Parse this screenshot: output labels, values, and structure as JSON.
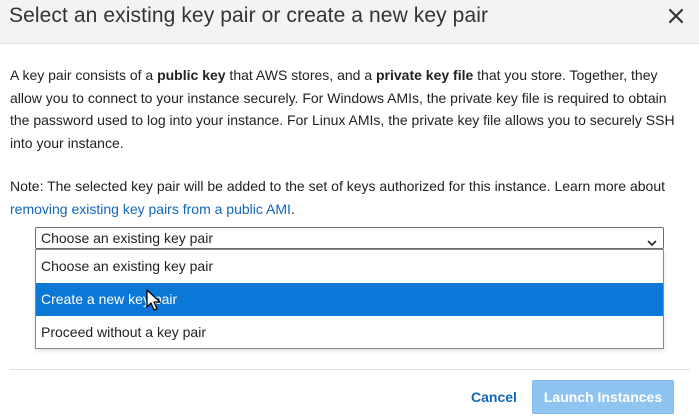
{
  "dialog": {
    "title": "Select an existing key pair or create a new key pair",
    "close_icon": "close-icon"
  },
  "intro": {
    "part1": "A key pair consists of a ",
    "bold1": "public key",
    "part2": " that AWS stores, and a ",
    "bold2": "private key file",
    "part3": " that you store. Together, they allow you to connect to your instance securely. For Windows AMIs, the private key file is required to obtain the password used to log into your instance. For Linux AMIs, the private key file allows you to securely SSH into your instance."
  },
  "note": {
    "text": "Note: The selected key pair will be added to the set of keys authorized for this instance. Learn more about ",
    "link": "removing existing key pairs from a public AMI",
    "suffix": "."
  },
  "select": {
    "value": "Choose an existing key pair",
    "options": [
      {
        "label": "Choose an existing key pair",
        "selected": false
      },
      {
        "label": "Create a new key pair",
        "selected": true
      },
      {
        "label": "Proceed without a key pair",
        "selected": false
      }
    ]
  },
  "footer": {
    "cancel_label": "Cancel",
    "launch_label": "Launch Instances",
    "launch_disabled": true
  },
  "colors": {
    "header_bg": "#f3f3f3",
    "link": "#1166bb",
    "highlight": "#0b78d7",
    "button_disabled": "#8fc4f0"
  }
}
